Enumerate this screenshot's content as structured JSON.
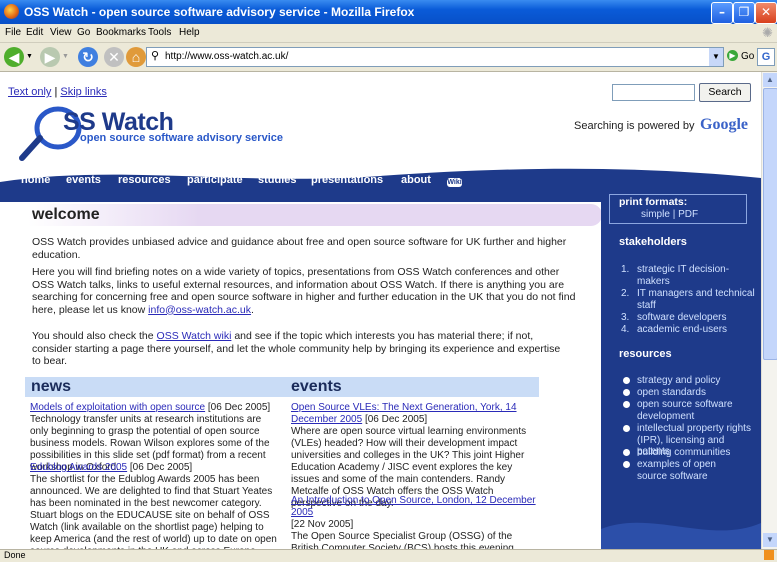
{
  "window": {
    "title": "OSS Watch - open source software advisory service - Mozilla Firefox"
  },
  "menu": [
    "File",
    "Edit",
    "View",
    "Go",
    "Bookmarks",
    "Tools",
    "Help"
  ],
  "toolbar": {
    "url": "http://www.oss-watch.ac.uk/",
    "go_label": "Go"
  },
  "status": "Done",
  "page": {
    "top_links": {
      "text_only": "Text only",
      "separator": "|",
      "skip_links": "Skip links"
    },
    "search_button": "Search",
    "search_powered": "Searching is powered by",
    "google": "Google",
    "logo": {
      "title": "SS Watch",
      "subtitle": "open source software advisory service"
    },
    "nav": [
      "home",
      "events",
      "resources",
      "participate",
      "studies",
      "presentations",
      "about"
    ],
    "nav_wiki": "Wiki",
    "welcome": {
      "heading": "welcome",
      "p1": "OSS Watch provides unbiased advice and guidance about free and open source software for UK further and higher education.",
      "p2_a": "Here you will find briefing notes on a wide variety of topics, presentations from OSS Watch conferences and other OSS Watch talks, links to useful external resources, and information about OSS Watch. If there is anything you are searching for concerning free and open source software in higher and further education in the UK that you do not find here, please let us know ",
      "p2_link": "info@oss-watch.ac.uk",
      "p2_b": ".",
      "p3_a": "You should also check the ",
      "p3_link": "OSS Watch wiki",
      "p3_b": " and see if the topic which interests you has material there; if not, consider starting a page there yourself, and let the whole community help by bringing its experience and expertise to bear."
    },
    "news": {
      "heading": "news",
      "items": [
        {
          "title": "Models of exploitation with open source",
          "date": "[06 Dec 2005]",
          "body": "Technology transfer units at research institutions are only beginning to grasp the potential of open source business models. Rowan Wilson explores some of the possibilities in this slide set (pdf format) from a recent workshop in Oxford."
        },
        {
          "title": "Edublog Awards 2005",
          "date": "[06 Dec 2005]",
          "body": "The shortlist for the Edublog Awards 2005 has been announced. We are delighted to find that Stuart Yeates has been nominated in the best newcomer category. Stuart blogs on the EDUCAUSE site on behalf of OSS Watch (link available on the shortlist page) helping to keep America (and the rest of world) up to date on open source developments in the UK and across Europe."
        }
      ]
    },
    "events": {
      "heading": "events",
      "items": [
        {
          "title": "Open Source VLEs: The Next Generation, York, 14 December 2005",
          "date": "[06 Dec 2005]",
          "body": "Where are open source virtual learning environments (VLEs) headed? How will their development impact universities and colleges in the UK? This joint Higher Education Academy / JISC event explores the key issues and some of the main contenders. Randy Metcalfe of OSS Watch offers the OSS Watch perspective on the day."
        },
        {
          "title": "An Introduction to Open Source, London, 12 December 2005",
          "date": "[22 Nov 2005]",
          "body": "The Open Source Specialist Group (OSSG) of the British Computer Society (BCS) hosts this evening event for IT managers and software developers. OSS Watch team..."
        }
      ]
    },
    "sidebar": {
      "print_heading": "print formats:",
      "print_simple": "simple",
      "print_sep": "|",
      "print_pdf": "PDF",
      "stakeholders_heading": "stakeholders",
      "stakeholders": [
        "strategic IT decision-makers",
        "IT managers and technical staff",
        "software developers",
        "academic end-users"
      ],
      "resources_heading": "resources",
      "resources": [
        "strategy and policy",
        "open standards",
        "open source software development",
        "intellectual property rights (IPR), licensing and patents",
        "building communities",
        "examples of open source software"
      ]
    }
  },
  "colors": {
    "nav_bg": "#1e3a8a",
    "heading_bg": "#c9dcf6",
    "welcome_bg": "#e6d8f2",
    "link": "#2a2ab8"
  }
}
